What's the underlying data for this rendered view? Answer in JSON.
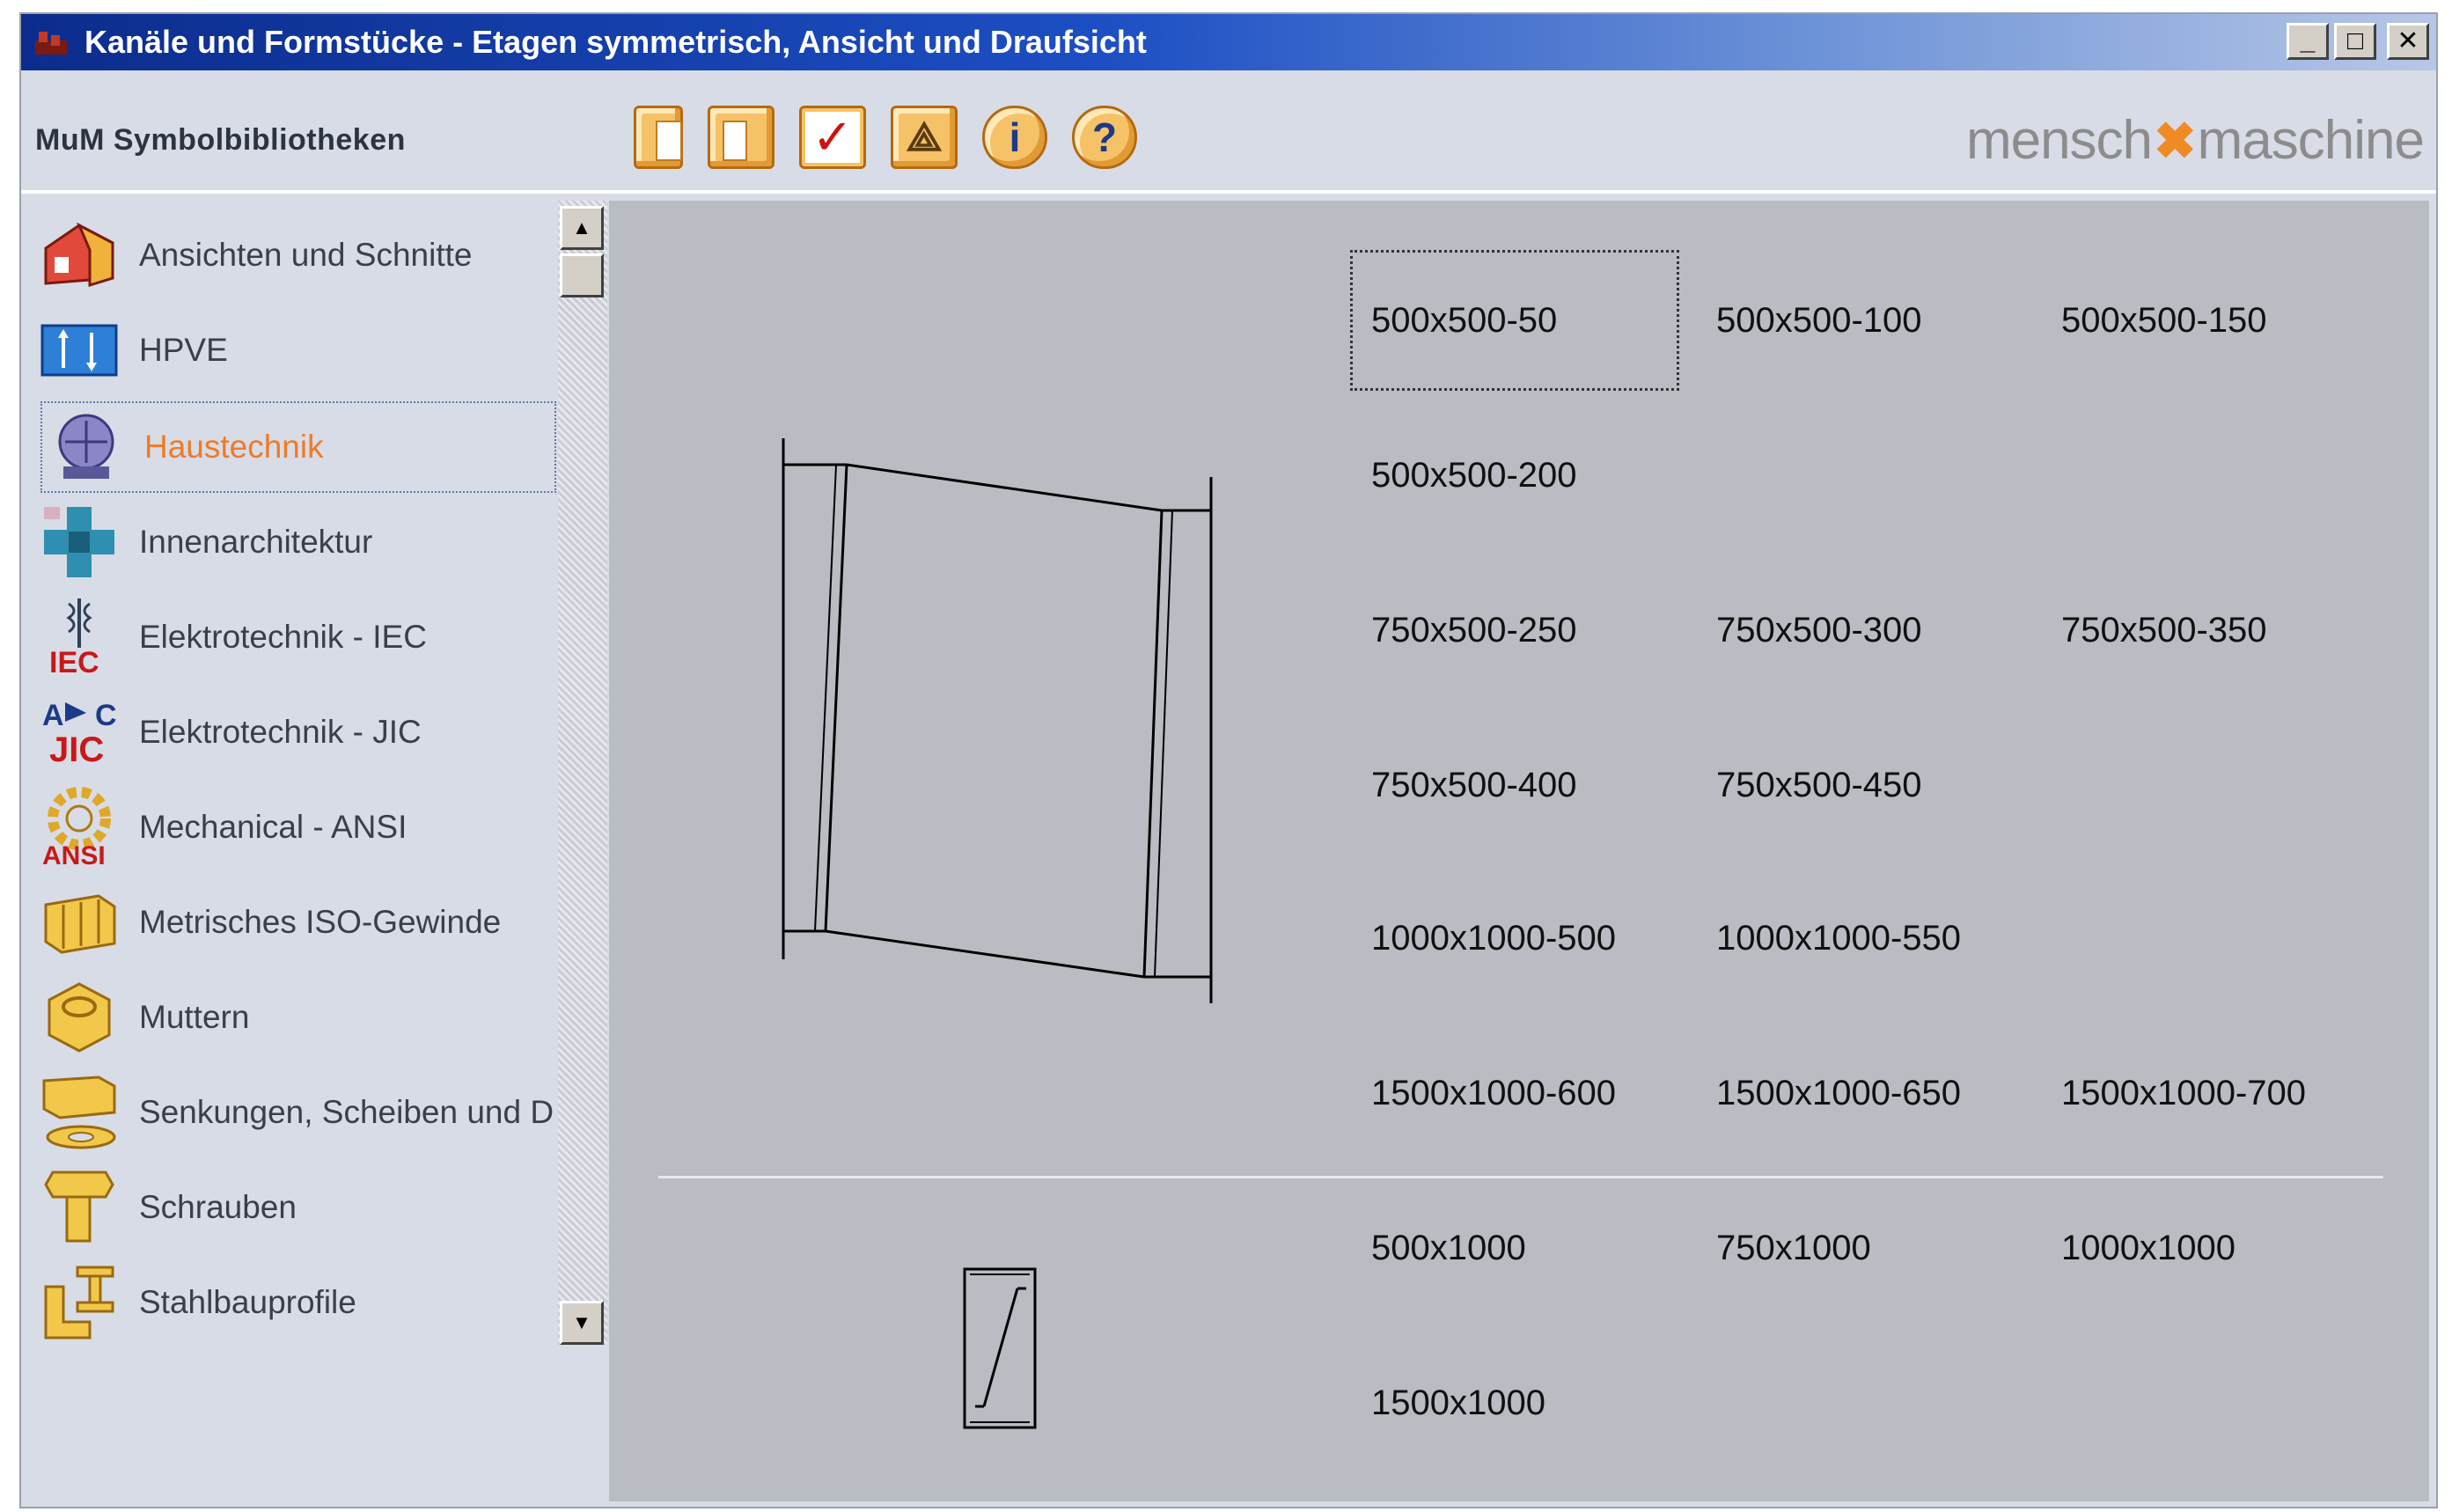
{
  "window": {
    "title": "Kanäle und Formstücke - Etagen symmetrisch, Ansicht und Draufsicht",
    "controls": {
      "minimize": "_",
      "maximize": "□",
      "close": "✕"
    }
  },
  "header": {
    "library_title": "MuM Symbolbibliotheken",
    "logo_left": "mensch",
    "logo_mark": "✖",
    "logo_right": "maschine",
    "toolbar_icons": [
      "new-sheet-icon",
      "half-sheet-icon",
      "check-icon",
      "drawing-icon",
      "info-icon",
      "help-icon"
    ],
    "toolbar_glyphs": {
      "check": "✓",
      "info": "i",
      "help": "?",
      "draw": "⟁"
    }
  },
  "sidebar": {
    "items": [
      {
        "label": "Ansichten und Schnitte",
        "icon": "house-icon"
      },
      {
        "label": "HPVE",
        "icon": "hpve-icon"
      },
      {
        "label": "Haustechnik",
        "icon": "building-services-icon",
        "selected": true
      },
      {
        "label": "Innenarchitektur",
        "icon": "interior-icon"
      },
      {
        "label": "Elektrotechnik - IEC",
        "icon": "iec-icon",
        "icon_text": "IEC"
      },
      {
        "label": "Elektrotechnik - JIC",
        "icon": "jic-icon",
        "icon_text": "JIC"
      },
      {
        "label": "Mechanical - ANSI",
        "icon": "ansi-gear-icon",
        "icon_text": "ANSI"
      },
      {
        "label": "Metrisches ISO-Gewinde",
        "icon": "thread-icon"
      },
      {
        "label": "Muttern",
        "icon": "nut-icon"
      },
      {
        "label": "Senkungen, Scheiben und Du",
        "icon": "washer-icon"
      },
      {
        "label": "Schrauben",
        "icon": "bolt-icon"
      },
      {
        "label": "Stahlbauprofile",
        "icon": "steel-profile-icon"
      }
    ],
    "scroll": {
      "up": "▲",
      "down": "▼"
    }
  },
  "main": {
    "section1": [
      [
        "500x500-50",
        "500x500-100",
        "500x500-150"
      ],
      [
        "500x500-200",
        "",
        ""
      ],
      [
        "750x500-250",
        "750x500-300",
        "750x500-350"
      ],
      [
        "750x500-400",
        "750x500-450",
        ""
      ],
      [
        "1000x1000-500",
        "1000x1000-550",
        ""
      ],
      [
        "1500x1000-600",
        "1500x1000-650",
        "1500x1000-700"
      ]
    ],
    "section2": [
      [
        "500x1000",
        "750x1000",
        "1000x1000"
      ],
      [
        "1500x1000",
        "",
        ""
      ]
    ],
    "focused_item": "500x500-50"
  }
}
